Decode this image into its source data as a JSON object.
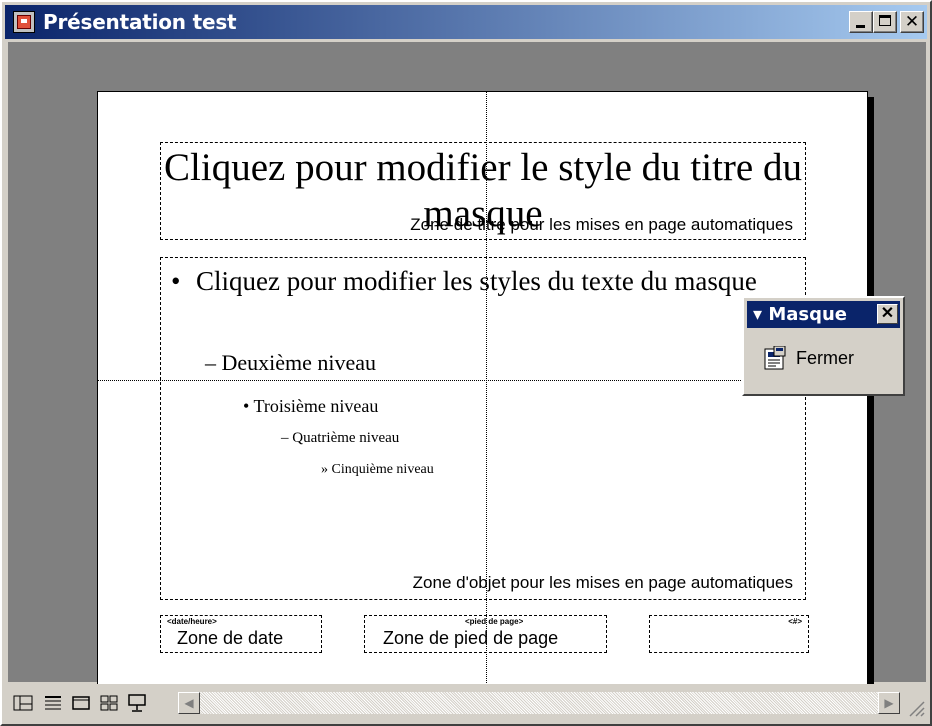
{
  "window": {
    "title": "Présentation test",
    "close_glyph": "✕"
  },
  "slide": {
    "title_placeholder": "Cliquez pour modifier le style du titre du masque",
    "title_zone_caption": "Zone de titre pour les mises en page automatiques",
    "body_bullets": [
      "Cliquez pour modifier les styles du texte du masque",
      "Deuxième niveau",
      "Troisième niveau",
      "Quatrième niveau",
      "Cinquième niveau"
    ],
    "bullet_marks": [
      "•",
      "–",
      "•",
      "–",
      "»"
    ],
    "body_zone_caption": "Zone d'objet pour les mises en page automatiques",
    "date_tag": "<date/heure>",
    "date_zone": "Zone de date",
    "footer_tag": "<pied de page>",
    "footer_zone": "Zone de pied de page",
    "number_tag": "<#>"
  },
  "master_toolbar": {
    "title": "Masque",
    "close_glyph": "✕",
    "fermer_label": "Fermer"
  },
  "statusbar": {
    "view_buttons": [
      "normal-view",
      "outline-view",
      "slide-view",
      "slide-sorter-view",
      "slide-show"
    ]
  },
  "colors": {
    "titlebar_start": "#0a246a",
    "titlebar_end": "#a6caf0",
    "face": "#d4d0c8",
    "workspace": "#808080"
  }
}
